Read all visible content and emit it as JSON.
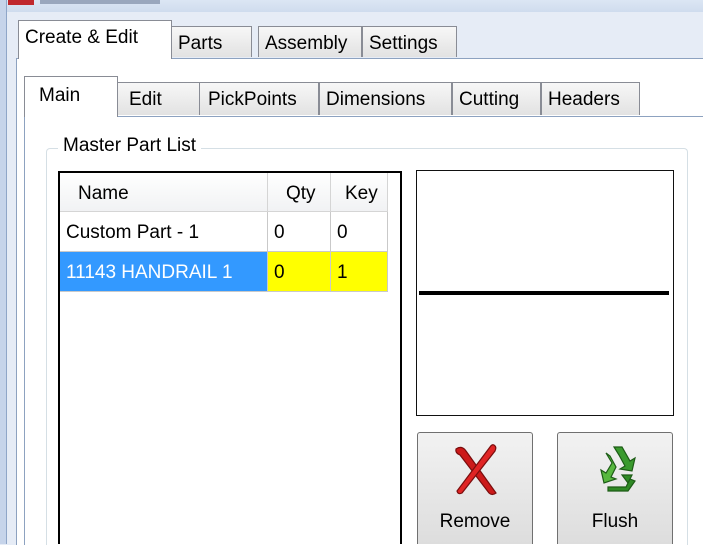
{
  "outer_tabs": [
    {
      "label": "Create & Edit",
      "active": true
    },
    {
      "label": "Parts"
    },
    {
      "label": "Assembly"
    },
    {
      "label": "Settings"
    }
  ],
  "inner_tabs": [
    {
      "label": "Main",
      "active": true
    },
    {
      "label": "Edit"
    },
    {
      "label": "PickPoints"
    },
    {
      "label": "Dimensions"
    },
    {
      "label": "Cutting"
    },
    {
      "label": "Headers"
    }
  ],
  "group": {
    "title": "Master Part List"
  },
  "parts_list": {
    "columns": [
      "Name",
      "Qty",
      "Key"
    ],
    "rows": [
      {
        "name": "Custom Part - 1",
        "qty": "0",
        "key": "0"
      },
      {
        "name": "11143 HANDRAIL 1",
        "qty": "0",
        "key": "1",
        "selected": true
      }
    ]
  },
  "buttons": {
    "remove": {
      "label": "Remove",
      "icon": "red-x-icon"
    },
    "flush": {
      "label": "Flush",
      "icon": "recycle-icon"
    }
  },
  "colors": {
    "selection_blue": "#3399ff",
    "highlight_yellow": "#ffff00"
  }
}
